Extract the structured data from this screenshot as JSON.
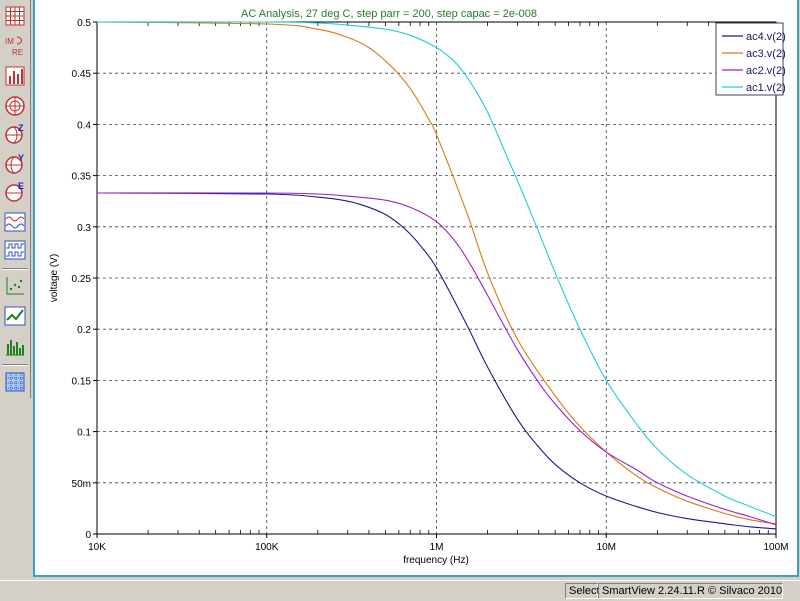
{
  "toolbar": {
    "items": [
      {
        "icon": "grid-icon"
      },
      {
        "icon": "smith-re-im-icon"
      },
      {
        "icon": "bar-chart-icon"
      },
      {
        "icon": "polar-plot-icon"
      },
      {
        "icon": "smith-chart-z-icon"
      },
      {
        "icon": "smith-chart-y-icon"
      },
      {
        "icon": "smith-chart-e-icon"
      },
      {
        "icon": "waveform-icon"
      },
      {
        "icon": "digital-waveform-icon"
      },
      {
        "icon": "scatter-plot-icon"
      },
      {
        "icon": "line-plot-icon"
      },
      {
        "icon": "histogram-icon"
      },
      {
        "icon": "surface-plot-icon"
      }
    ]
  },
  "chart_data": {
    "type": "line",
    "title": "AC Analysis, 27 deg C, step parr = 200, step capac = 2e-008",
    "xlabel": "frequency (Hz)",
    "ylabel": "voltage (V)",
    "xscale": "log",
    "xlim": [
      10000,
      100000000
    ],
    "ylim": [
      0,
      0.5
    ],
    "x_ticks": [
      {
        "value": 10000,
        "label": "10K"
      },
      {
        "value": 100000,
        "label": "100K"
      },
      {
        "value": 1000000,
        "label": "1M"
      },
      {
        "value": 10000000,
        "label": "10M"
      },
      {
        "value": 100000000,
        "label": "100M"
      }
    ],
    "y_ticks": [
      {
        "value": 0,
        "label": "0"
      },
      {
        "value": 0.05,
        "label": "50m"
      },
      {
        "value": 0.1,
        "label": "0.1"
      },
      {
        "value": 0.15,
        "label": "0.15"
      },
      {
        "value": 0.2,
        "label": "0.2"
      },
      {
        "value": 0.25,
        "label": "0.25"
      },
      {
        "value": 0.3,
        "label": "0.3"
      },
      {
        "value": 0.35,
        "label": "0.35"
      },
      {
        "value": 0.4,
        "label": "0.4"
      },
      {
        "value": 0.45,
        "label": "0.45"
      },
      {
        "value": 0.5,
        "label": "0.5"
      }
    ],
    "grid": true,
    "legend_position": "top-right",
    "series": [
      {
        "name": "ac4.v(2)",
        "color": "#1a1a8c",
        "x": [
          10000,
          100000,
          200000,
          300000,
          400000,
          500000,
          600000,
          700000,
          800000,
          1000000,
          1500000,
          2000000,
          3000000,
          4000000,
          5000000,
          7000000,
          10000000,
          15000000,
          20000000,
          30000000,
          50000000,
          70000000,
          100000000
        ],
        "y": [
          0.333,
          0.332,
          0.329,
          0.325,
          0.319,
          0.312,
          0.303,
          0.293,
          0.282,
          0.26,
          0.205,
          0.163,
          0.112,
          0.085,
          0.068,
          0.05,
          0.037,
          0.027,
          0.021,
          0.015,
          0.01,
          0.007,
          0.005
        ]
      },
      {
        "name": "ac3.v(2)",
        "color": "#d97a10",
        "x": [
          10000,
          100000,
          200000,
          300000,
          400000,
          500000,
          600000,
          700000,
          800000,
          900000,
          1000000,
          1500000,
          2000000,
          3000000,
          5000000,
          7000000,
          10000000,
          15000000,
          20000000,
          30000000,
          50000000,
          70000000,
          100000000
        ],
        "y": [
          0.5,
          0.498,
          0.493,
          0.485,
          0.475,
          0.462,
          0.449,
          0.435,
          0.42,
          0.405,
          0.39,
          0.315,
          0.255,
          0.19,
          0.135,
          0.105,
          0.08,
          0.057,
          0.045,
          0.032,
          0.02,
          0.014,
          0.01
        ]
      },
      {
        "name": "ac2.v(2)",
        "color": "#9922cc",
        "x": [
          10000,
          100000,
          200000,
          300000,
          500000,
          700000,
          1000000,
          1300000,
          1600000,
          2000000,
          3000000,
          4000000,
          5000000,
          7000000,
          10000000,
          15000000,
          20000000,
          30000000,
          50000000,
          70000000,
          100000000
        ],
        "y": [
          0.333,
          0.333,
          0.332,
          0.33,
          0.326,
          0.319,
          0.305,
          0.285,
          0.262,
          0.233,
          0.18,
          0.148,
          0.127,
          0.101,
          0.08,
          0.063,
          0.05,
          0.037,
          0.024,
          0.017,
          0.009
        ]
      },
      {
        "name": "ac1.v(2)",
        "color": "#22ccdd",
        "x": [
          10000,
          100000,
          200000,
          300000,
          500000,
          700000,
          1000000,
          1300000,
          1600000,
          2000000,
          2500000,
          3000000,
          4000000,
          5000000,
          7000000,
          10000000,
          15000000,
          20000000,
          30000000,
          50000000,
          70000000,
          100000000
        ],
        "y": [
          0.5,
          0.5,
          0.499,
          0.497,
          0.493,
          0.487,
          0.475,
          0.46,
          0.44,
          0.412,
          0.375,
          0.345,
          0.295,
          0.255,
          0.2,
          0.15,
          0.108,
          0.083,
          0.058,
          0.037,
          0.027,
          0.017
        ]
      }
    ]
  },
  "statusbar": {
    "mode": "Select",
    "app": "SmartView 2.24.11.R © Silvaco 2010"
  }
}
